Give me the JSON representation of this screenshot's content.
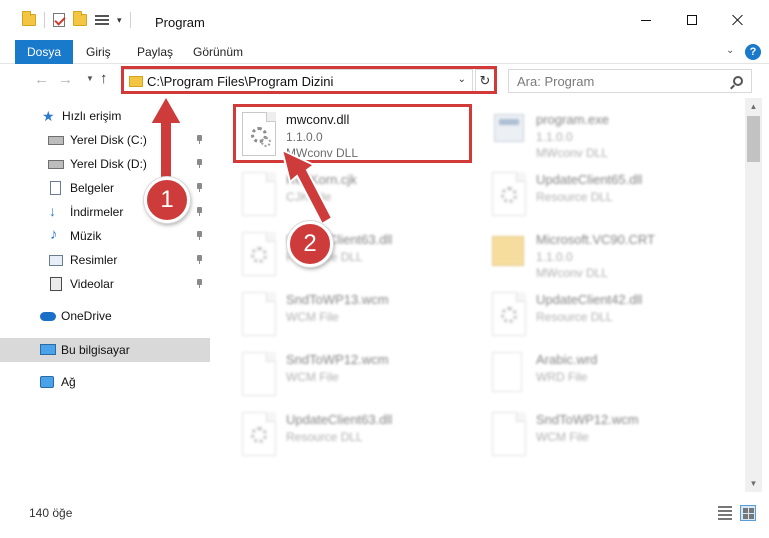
{
  "window": {
    "title": "Program"
  },
  "ribbon": {
    "tabs": [
      {
        "label": "Dosya"
      },
      {
        "label": "Giriş"
      },
      {
        "label": "Paylaş"
      },
      {
        "label": "Görünüm"
      }
    ],
    "help": "?"
  },
  "navigation": {
    "address": "C:\\Program Files\\Program Dizini",
    "search_placeholder": "Ara: Program"
  },
  "sidebar": {
    "items": [
      {
        "label": "Hızlı erişim",
        "icon": "star-icon",
        "pinned": false
      },
      {
        "label": "Yerel Disk (C:)",
        "icon": "drive-icon",
        "pinned": true
      },
      {
        "label": "Yerel Disk (D:)",
        "icon": "drive-icon",
        "pinned": true
      },
      {
        "label": "Belgeler",
        "icon": "documents-icon",
        "pinned": true
      },
      {
        "label": "İndirmeler",
        "icon": "download-icon",
        "pinned": true
      },
      {
        "label": "Müzik",
        "icon": "music-icon",
        "pinned": true
      },
      {
        "label": "Resimler",
        "icon": "pictures-icon",
        "pinned": true
      },
      {
        "label": "Videolar",
        "icon": "videos-icon",
        "pinned": true
      },
      {
        "label": "OneDrive",
        "icon": "onedrive-icon",
        "pinned": false
      },
      {
        "label": "Bu bilgisayar",
        "icon": "computer-icon",
        "pinned": false,
        "selected": true
      },
      {
        "label": "Ağ",
        "icon": "network-icon",
        "pinned": false
      }
    ]
  },
  "files": [
    {
      "name": "mwconv.dll",
      "line2": "1.1.0.0",
      "line3": "MWconv DLL",
      "icon": "dll-file-icon"
    },
    {
      "name": "program.exe",
      "line2": "1.1.0.0",
      "line3": "MWconv DLL",
      "icon": "exe-file-icon"
    },
    {
      "name": "RedKorn.cjk",
      "line2": "CJK File",
      "line3": "",
      "icon": "generic-file-icon"
    },
    {
      "name": "UpdateClient65.dll",
      "line2": "Resource DLL",
      "line3": "",
      "icon": "dll-file-icon"
    },
    {
      "name": "UpdateClient63.dll",
      "line2": "Resource DLL",
      "line3": "",
      "icon": "dll-file-icon"
    },
    {
      "name": "Microsoft.VC90.CRT",
      "line2": "1.1.0.0",
      "line3": "MWconv DLL",
      "icon": "folder-icon"
    },
    {
      "name": "SndToWP13.wcm",
      "line2": "WCM File",
      "line3": "",
      "icon": "generic-file-icon"
    },
    {
      "name": "UpdateClient42.dll",
      "line2": "Resource DLL",
      "line3": "",
      "icon": "dll-file-icon"
    },
    {
      "name": "SndToWP12.wcm",
      "line2": "WCM File",
      "line3": "",
      "icon": "generic-file-icon"
    },
    {
      "name": "Arabic.wrd",
      "line2": "WRD File",
      "line3": "",
      "icon": "generic-file-icon"
    },
    {
      "name": "UpdateClient63.dll",
      "line2": "Resource DLL",
      "line3": "",
      "icon": "dll-file-icon"
    },
    {
      "name": "SndToWP12.wcm",
      "line2": "WCM File",
      "line3": "",
      "icon": "generic-file-icon"
    }
  ],
  "status": {
    "count": "140 öğe"
  },
  "callouts": {
    "one": "1",
    "two": "2"
  },
  "colors": {
    "accent": "#1979ca",
    "highlight_red": "#d23a3a",
    "callout_red": "#cd3b3b",
    "selected_bg": "#d9d9d9"
  }
}
